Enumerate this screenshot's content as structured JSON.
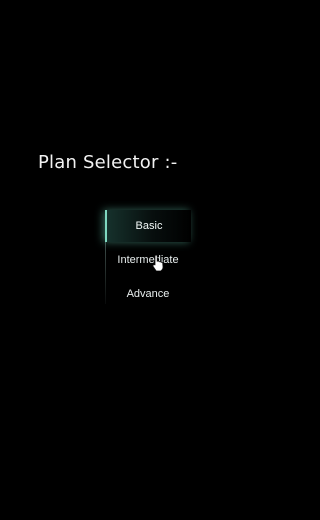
{
  "title": "Plan Selector :-",
  "plan_selector": {
    "options": [
      {
        "label": "Basic",
        "selected": true
      },
      {
        "label": "Intermediate",
        "selected": false
      },
      {
        "label": "Advance",
        "selected": false
      }
    ],
    "hovered": "Intermediate"
  },
  "colors": {
    "background": "#000000",
    "text": "#f2f2f2",
    "accent": "#7fd8c0"
  },
  "icons": {
    "cursor": "hand-pointer-icon"
  }
}
